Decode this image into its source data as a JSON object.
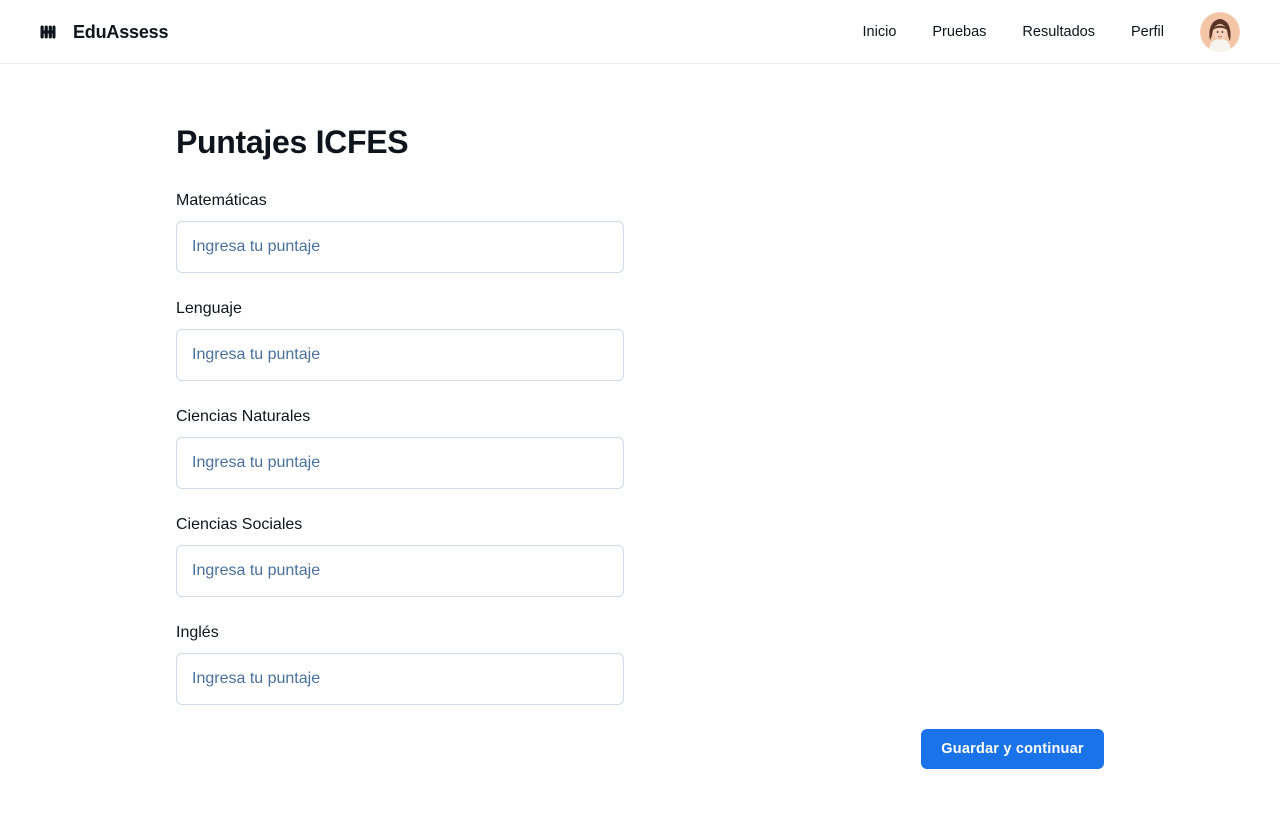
{
  "header": {
    "brand_name": "EduAssess",
    "nav": [
      {
        "label": "Inicio"
      },
      {
        "label": "Pruebas"
      },
      {
        "label": "Resultados"
      },
      {
        "label": "Perfil"
      }
    ]
  },
  "main": {
    "title": "Puntajes ICFES",
    "fields": [
      {
        "label": "Matemáticas",
        "value": "",
        "placeholder": "Ingresa tu puntaje"
      },
      {
        "label": "Lenguaje",
        "value": "",
        "placeholder": "Ingresa tu puntaje"
      },
      {
        "label": "Ciencias Naturales",
        "value": "",
        "placeholder": "Ingresa tu puntaje"
      },
      {
        "label": "Ciencias Sociales",
        "value": "",
        "placeholder": "Ingresa tu puntaje"
      },
      {
        "label": "Inglés",
        "value": "",
        "placeholder": "Ingresa tu puntaje"
      }
    ],
    "submit_label": "Guardar y continuar"
  },
  "colors": {
    "accent": "#1a73e8",
    "text": "#0d141c",
    "placeholder": "#49719c",
    "input_border": "#cfdbe8"
  },
  "icons": {
    "logo": "eduassess-logo-icon",
    "avatar": "user-avatar"
  }
}
